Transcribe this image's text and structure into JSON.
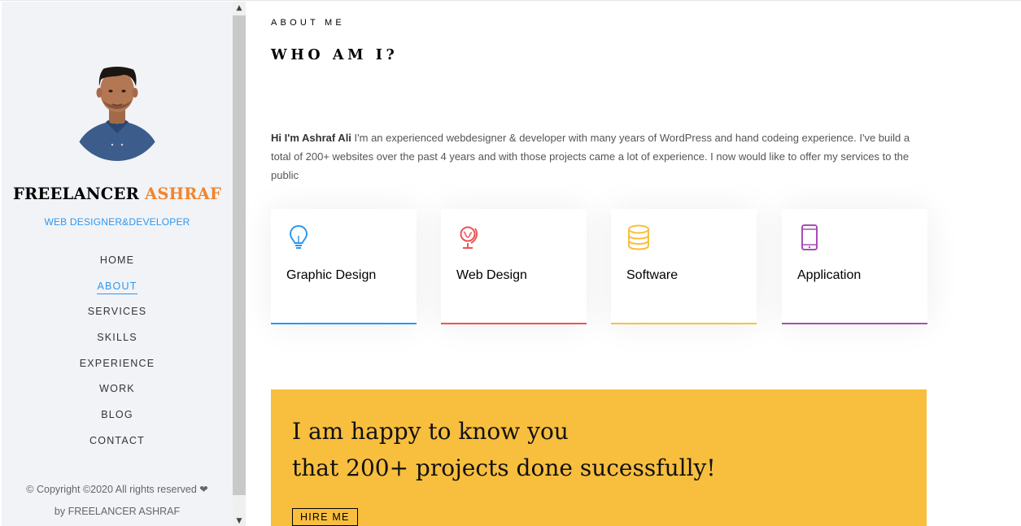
{
  "sidebar": {
    "brand_first": "FREELANCER",
    "brand_second": "ASHRAF",
    "tagline": "WEB DESIGNER&DEVELOPER",
    "nav": [
      {
        "label": "HOME"
      },
      {
        "label": "ABOUT",
        "active": true
      },
      {
        "label": "SERVICES"
      },
      {
        "label": "SKILLS"
      },
      {
        "label": "EXPERIENCE"
      },
      {
        "label": "WORK"
      },
      {
        "label": "BLOG"
      },
      {
        "label": "CONTACT"
      }
    ],
    "copyright_line1": "© Copyright ©2020 All rights reserved ❤",
    "copyright_line2": "by FREELANCER ASHRAF"
  },
  "about": {
    "eyebrow": "ABOUT ME",
    "heading": "WHO AM I?",
    "intro_name": "Hi I'm Ashraf Ali",
    "intro_text": " I'm an experienced webdesigner & developer with many years of WordPress and hand codeing experience. I've build a total of 200+ websites over the past 4 years and with those projects came a lot of experience. I now would like to offer my services to the public"
  },
  "services": [
    {
      "label": "Graphic Design",
      "icon": "lightbulb-icon",
      "color": "#2c98f0"
    },
    {
      "label": "Web Design",
      "icon": "globe-icon",
      "color": "#ec5453"
    },
    {
      "label": "Software",
      "icon": "database-icon",
      "color": "#f9bf3f"
    },
    {
      "label": "Application",
      "icon": "phone-icon",
      "color": "#a84cb8"
    }
  ],
  "cta": {
    "line1": "I am happy to know you",
    "line2": "that 200+ projects done sucessfully!",
    "button": "HIRE ME",
    "background": "#f8be3e"
  },
  "colors": {
    "accent_blue": "#2c98f0",
    "accent_orange": "#f0852d",
    "sidebar_bg": "#f2f3f7"
  }
}
